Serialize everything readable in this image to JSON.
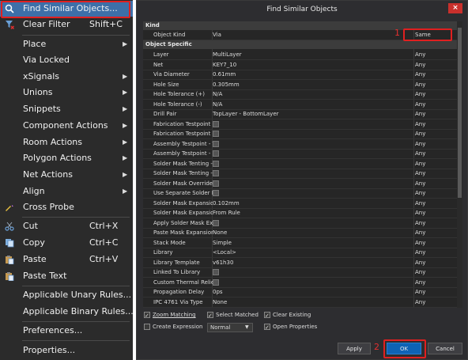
{
  "menu": {
    "items": [
      {
        "label": "Find Similar Objects...",
        "shortcut": "",
        "submenu": false,
        "icon": "magnifier-icon"
      },
      {
        "label": "Clear Filter",
        "shortcut": "Shift+C",
        "submenu": false,
        "icon": "filter-clear-icon"
      },
      {
        "label": "Place",
        "shortcut": "",
        "submenu": true,
        "icon": ""
      },
      {
        "label": "Via Locked",
        "shortcut": "",
        "submenu": false,
        "icon": ""
      },
      {
        "label": "xSignals",
        "shortcut": "",
        "submenu": true,
        "icon": ""
      },
      {
        "label": "Unions",
        "shortcut": "",
        "submenu": true,
        "icon": ""
      },
      {
        "label": "Snippets",
        "shortcut": "",
        "submenu": true,
        "icon": ""
      },
      {
        "label": "Component Actions",
        "shortcut": "",
        "submenu": true,
        "icon": ""
      },
      {
        "label": "Room Actions",
        "shortcut": "",
        "submenu": true,
        "icon": ""
      },
      {
        "label": "Polygon Actions",
        "shortcut": "",
        "submenu": true,
        "icon": ""
      },
      {
        "label": "Net Actions",
        "shortcut": "",
        "submenu": true,
        "icon": ""
      },
      {
        "label": "Align",
        "shortcut": "",
        "submenu": true,
        "icon": ""
      },
      {
        "label": "Cross Probe",
        "shortcut": "",
        "submenu": false,
        "icon": "cross-probe-icon"
      },
      {
        "label": "Cut",
        "shortcut": "Ctrl+X",
        "submenu": false,
        "icon": "scissors-icon"
      },
      {
        "label": "Copy",
        "shortcut": "Ctrl+C",
        "submenu": false,
        "icon": "copy-icon"
      },
      {
        "label": "Paste",
        "shortcut": "Ctrl+V",
        "submenu": false,
        "icon": "paste-icon"
      },
      {
        "label": "Paste Text",
        "shortcut": "",
        "submenu": false,
        "icon": "paste-text-icon"
      },
      {
        "label": "Applicable Unary Rules...",
        "shortcut": "",
        "submenu": false,
        "icon": ""
      },
      {
        "label": "Applicable Binary Rules...",
        "shortcut": "",
        "submenu": false,
        "icon": ""
      },
      {
        "label": "Preferences...",
        "shortcut": "",
        "submenu": false,
        "icon": ""
      },
      {
        "label": "Properties...",
        "shortcut": "",
        "submenu": false,
        "icon": ""
      }
    ]
  },
  "dialog": {
    "title": "Find Similar Objects",
    "close_label": "×",
    "sections": {
      "kind": "Kind",
      "object_specific": "Object Specific"
    },
    "kind_row": {
      "name": "Object Kind",
      "value": "Via",
      "match": "Same"
    },
    "rows": [
      {
        "name": "Layer",
        "value": "MultiLayer",
        "match": "Any",
        "checkbox": false
      },
      {
        "name": "Net",
        "value": "KEY7_10",
        "match": "Any",
        "checkbox": false
      },
      {
        "name": "Via Diameter",
        "value": "0.61mm",
        "match": "Any",
        "checkbox": false
      },
      {
        "name": "Hole Size",
        "value": "0.305mm",
        "match": "Any",
        "checkbox": false
      },
      {
        "name": "Hole Tolerance (+)",
        "value": "N/A",
        "match": "Any",
        "checkbox": false
      },
      {
        "name": "Hole Tolerance (-)",
        "value": "N/A",
        "match": "Any",
        "checkbox": false
      },
      {
        "name": "Drill Pair",
        "value": "TopLayer - BottomLayer",
        "match": "Any",
        "checkbox": false
      },
      {
        "name": "Fabrication Testpoint -",
        "value": "",
        "match": "Any",
        "checkbox": true
      },
      {
        "name": "Fabrication Testpoint -",
        "value": "",
        "match": "Any",
        "checkbox": true
      },
      {
        "name": "Assembly Testpoint - T",
        "value": "",
        "match": "Any",
        "checkbox": true
      },
      {
        "name": "Assembly Testpoint - B",
        "value": "",
        "match": "Any",
        "checkbox": true
      },
      {
        "name": "Solder Mask Tenting -",
        "value": "",
        "match": "Any",
        "checkbox": true
      },
      {
        "name": "Solder Mask Tenting -",
        "value": "",
        "match": "Any",
        "checkbox": true
      },
      {
        "name": "Solder Mask Override",
        "value": "",
        "match": "Any",
        "checkbox": true
      },
      {
        "name": "Use Separate Solder M",
        "value": "",
        "match": "Any",
        "checkbox": true
      },
      {
        "name": "Solder Mask Expansion",
        "value": "0.102mm",
        "match": "Any",
        "checkbox": false
      },
      {
        "name": "Solder Mask Expansion",
        "value": "From Rule",
        "match": "Any",
        "checkbox": false
      },
      {
        "name": "Apply Solder Mask Exp",
        "value": "",
        "match": "Any",
        "checkbox": true
      },
      {
        "name": "Paste Mask Expansion",
        "value": "None",
        "match": "Any",
        "checkbox": false
      },
      {
        "name": "Stack Mode",
        "value": "Simple",
        "match": "Any",
        "checkbox": false
      },
      {
        "name": "Library",
        "value": "<Local>",
        "match": "Any",
        "checkbox": false
      },
      {
        "name": "Library Template",
        "value": "v61h30",
        "match": "Any",
        "checkbox": false
      },
      {
        "name": "Linked To Library",
        "value": "",
        "match": "Any",
        "checkbox": true
      },
      {
        "name": "Custom Thermal Relief",
        "value": "",
        "match": "Any",
        "checkbox": true
      },
      {
        "name": "Propagation Delay",
        "value": "0ps",
        "match": "Any",
        "checkbox": false
      },
      {
        "name": "IPC 4761 Via Type",
        "value": "None",
        "match": "Any",
        "checkbox": false
      }
    ],
    "options": {
      "zoom_matching": "Zoom Matching",
      "select_matched": "Select Matched",
      "clear_existing": "Clear Existing",
      "create_expression": "Create Expression",
      "mode_value": "Normal",
      "open_properties": "Open Properties"
    },
    "buttons": {
      "apply": "Apply",
      "ok": "OK",
      "cancel": "Cancel"
    },
    "annotations": {
      "one": "1",
      "two": "2"
    },
    "colors": {
      "highlight": "#3d6fa8",
      "primary": "#0e63b5",
      "annotation_red": "#e02020"
    }
  }
}
